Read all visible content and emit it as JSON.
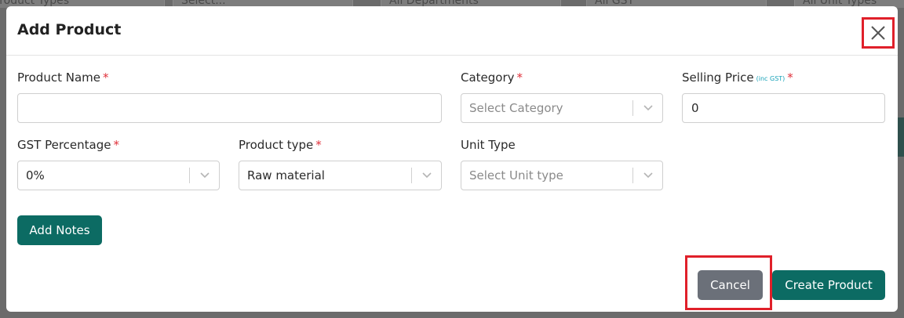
{
  "background": {
    "filters": [
      "Product Types",
      "Select...",
      "All Departments",
      "All GST",
      "All Unit Types"
    ]
  },
  "modal": {
    "title": "Add Product",
    "close_icon": "close-icon",
    "fields": {
      "product_name": {
        "label": "Product Name",
        "required": "*",
        "value": ""
      },
      "category": {
        "label": "Category",
        "required": "*",
        "placeholder": "Select Category"
      },
      "selling_price": {
        "label": "Selling Price",
        "sublabel": "(inc GST)",
        "required": "*",
        "value": "0"
      },
      "gst_percentage": {
        "label": "GST Percentage",
        "required": "*",
        "value": "0%"
      },
      "product_type": {
        "label": "Product type",
        "required": "*",
        "value": "Raw material"
      },
      "unit_type": {
        "label": "Unit Type",
        "placeholder": "Select Unit type"
      }
    },
    "buttons": {
      "add_notes": "Add Notes",
      "cancel": "Cancel",
      "create": "Create Product"
    }
  },
  "colors": {
    "primary": "#0c6b63",
    "secondary": "#6b7079",
    "required": "#e0303a",
    "highlight": "#e0202a",
    "accent_text": "#17a2b8"
  }
}
